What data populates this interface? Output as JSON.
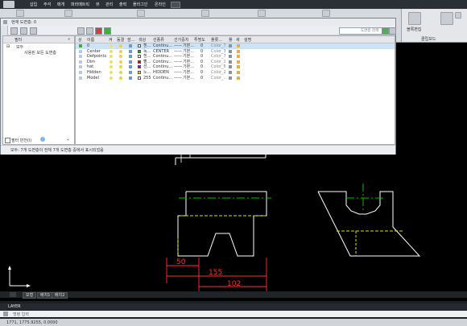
{
  "menu": {
    "items": [
      "삽입",
      "주석",
      "매개",
      "파라메트릭",
      "뷰",
      "관리",
      "출력",
      "플러그인",
      "온라인"
    ]
  },
  "ribbon_right": {
    "label": "블록편집",
    "panel_title": "클립보드"
  },
  "layer_manager": {
    "title": "현재 도면층: 0",
    "search_placeholder": "도면층 검색",
    "filter_header": "필터",
    "filter_root": "모두",
    "filter_child": "사용된 모든 도면층",
    "invert_filter_label": "필터 반전(I)",
    "columns": [
      "상",
      "이름",
      "켜",
      "동결",
      "잠...",
      "색상",
      "선종류",
      "선가중치",
      "투명도",
      "플롯...",
      "플",
      "새",
      "설명"
    ],
    "rows": [
      {
        "name": "0",
        "color_name": "흰...",
        "color": "#ffffff",
        "linetype": "Continu...",
        "lineweight": "기본...",
        "transparency": "0",
        "plotstyle": "Color_7",
        "selected": true
      },
      {
        "name": "Center",
        "color_name": "녹...",
        "color": "#00c000",
        "linetype": "CENTER",
        "lineweight": "기본...",
        "transparency": "0",
        "plotstyle": "Color_3",
        "selected": false
      },
      {
        "name": "Defpoints",
        "color_name": "흰...",
        "color": "#ffffff",
        "linetype": "Continu...",
        "lineweight": "기본...",
        "transparency": "0",
        "plotstyle": "Color_7",
        "selected": false
      },
      {
        "name": "Dim",
        "color_name": "빨...",
        "color": "#e00000",
        "linetype": "Continu...",
        "lineweight": "기본...",
        "transparency": "0",
        "plotstyle": "Color_1",
        "selected": false
      },
      {
        "name": "hat",
        "color_name": "선...",
        "color": "#c000c0",
        "linetype": "Continu...",
        "lineweight": "기본...",
        "transparency": "0",
        "plotstyle": "Color_6",
        "selected": false
      },
      {
        "name": "Hidden",
        "color_name": "노...",
        "color": "#e0e000",
        "linetype": "HIDDEN",
        "lineweight": "기본...",
        "transparency": "0",
        "plotstyle": "Color_2",
        "selected": false
      },
      {
        "name": "Model",
        "color_name": "255",
        "color": "#ffffff",
        "linetype": "Continu...",
        "lineweight": "기본...",
        "transparency": "0",
        "plotstyle": "Color_...",
        "selected": false
      }
    ],
    "status": "모두: 7개 도면층이 전체 7개 도면층 중에서 표시되었음"
  },
  "drawing": {
    "dims": [
      "50",
      "155",
      "102"
    ]
  },
  "bottom": {
    "tabs": [
      "모형",
      "배치1",
      "배치2"
    ],
    "command_history": "LAYER",
    "command_prompt": "명령 입력",
    "status_coords": "1771, 1775.9255, 0.0000"
  },
  "colors": {
    "dim": "#ff3030",
    "center": "#00c000",
    "hidden": "#e0e000",
    "object": "#ffffff"
  }
}
